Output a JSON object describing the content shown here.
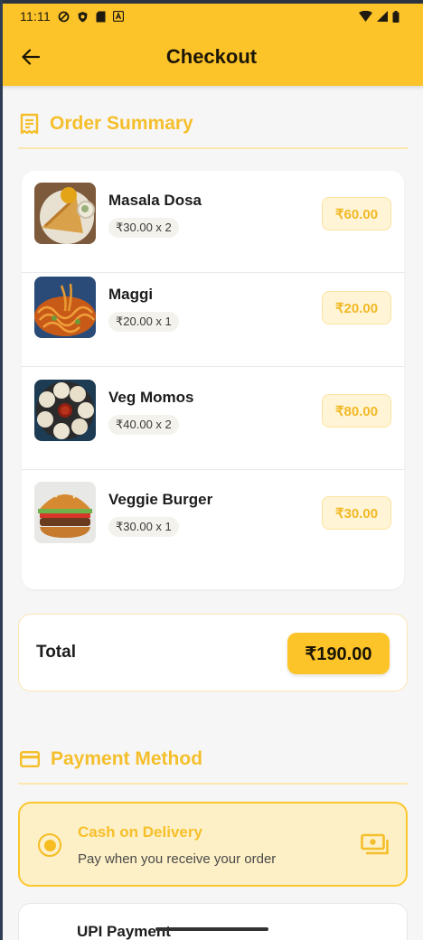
{
  "status_bar": {
    "time": "11:11"
  },
  "header": {
    "title": "Checkout"
  },
  "order_summary": {
    "heading": "Order Summary",
    "items": [
      {
        "name": "Masala Dosa",
        "qty": "₹30.00 x 2",
        "total": "₹60.00"
      },
      {
        "name": "Maggi",
        "qty": "₹20.00 x 1",
        "total": "₹20.00"
      },
      {
        "name": "Veg Momos",
        "qty": "₹40.00 x 2",
        "total": "₹80.00"
      },
      {
        "name": "Veggie Burger",
        "qty": "₹30.00 x 1",
        "total": "₹30.00"
      }
    ]
  },
  "total": {
    "label": "Total",
    "value": "₹190.00"
  },
  "payment": {
    "heading": "Payment Method",
    "options": [
      {
        "title": "Cash on Delivery",
        "subtitle": "Pay when you receive your order",
        "selected": true,
        "icon": "cash-icon"
      },
      {
        "title": "UPI Payment",
        "selected": false
      }
    ]
  },
  "colors": {
    "primary": "#fdc42a",
    "accent_text": "#f5bf2b",
    "background": "#f6f6f6"
  }
}
